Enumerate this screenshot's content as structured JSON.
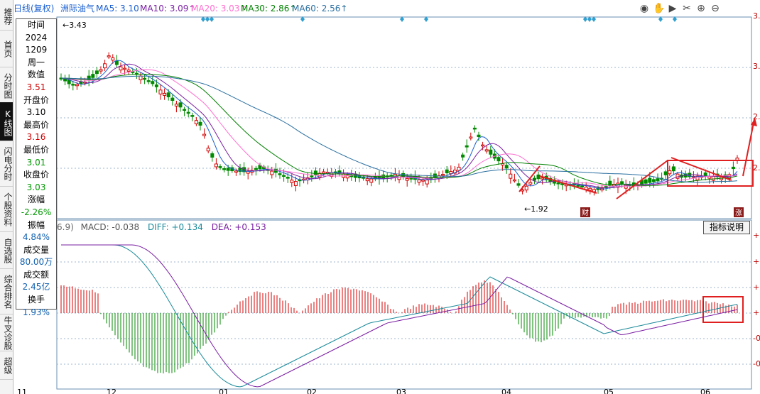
{
  "sidebar": {
    "tabs": [
      {
        "label": "推荐",
        "active": false
      },
      {
        "label": "首页",
        "active": false
      },
      {
        "label": "分时图",
        "active": false
      },
      {
        "label": "K线图",
        "active": true
      },
      {
        "label": "闪电分时",
        "active": false
      },
      {
        "label": "个股资料",
        "active": false
      },
      {
        "label": "自选股",
        "active": false
      },
      {
        "label": "综合排名",
        "active": false
      },
      {
        "label": "牛叉诊股",
        "active": false
      },
      {
        "label": "超级",
        "active": false
      }
    ]
  },
  "header": {
    "period": "日线(复权)",
    "stock_name": "洲际油气",
    "ma": [
      {
        "label": "MA5: 3.10",
        "color": "#1a5fd0"
      },
      {
        "label": "MA10: 3.09↑",
        "color": "#7a1fa2"
      },
      {
        "label": "MA20: 3.03↑",
        "color": "#ff6fd0"
      },
      {
        "label": "MA30: 2.86↑",
        "color": "#008000"
      },
      {
        "label": "MA60: 2.56↑",
        "color": "#2a6fa0"
      }
    ],
    "icons": [
      "eye-icon",
      "hand-icon",
      "play-icon",
      "scissors-icon",
      "zoom-in-icon",
      "zoom-out-icon"
    ]
  },
  "infopanel": {
    "rows": [
      {
        "text": "时间",
        "cls": "v"
      },
      {
        "text": "2024",
        "cls": "v"
      },
      {
        "text": "1209",
        "cls": "v"
      },
      {
        "text": "周一",
        "cls": "v"
      },
      {
        "text": "数值",
        "cls": "v"
      },
      {
        "text": "3.51",
        "cls": "red"
      },
      {
        "text": "开盘价",
        "cls": "v"
      },
      {
        "text": "3.10",
        "cls": "v"
      },
      {
        "text": "最高价",
        "cls": "v"
      },
      {
        "text": "3.16",
        "cls": "red"
      },
      {
        "text": "最低价",
        "cls": "v"
      },
      {
        "text": "3.01",
        "cls": "green"
      },
      {
        "text": "收盘价",
        "cls": "v"
      },
      {
        "text": "3.03",
        "cls": "green"
      },
      {
        "text": "涨幅",
        "cls": "v"
      },
      {
        "text": "-2.26%",
        "cls": "green"
      },
      {
        "text": "振幅",
        "cls": "v"
      },
      {
        "text": "4.84%",
        "cls": "blue"
      },
      {
        "text": "成交量",
        "cls": "v"
      },
      {
        "text": "80.00万",
        "cls": "blue"
      },
      {
        "text": "成交额",
        "cls": "v"
      },
      {
        "text": "2.45亿",
        "cls": "blue"
      },
      {
        "text": "换手",
        "cls": "v"
      },
      {
        "text": "1.93%",
        "cls": "blue"
      }
    ]
  },
  "price_labels": {
    "high": "3.43",
    "low": "1.92",
    "badge_cai": "财",
    "badge_zhang": "涨"
  },
  "macd": {
    "params": "6.9)",
    "macd_label": "MACD: -0.038",
    "diff_label": "DIFF: +0.134",
    "dea_label": "DEA: +0.153",
    "explain_button": "指标说明"
  },
  "axis": {
    "price_ticks": [
      "3.",
      "3.",
      "2.",
      "2."
    ],
    "macd_ticks": [
      "+0",
      "+0",
      "+0",
      "+0",
      "-0",
      "-0"
    ],
    "months": [
      "11",
      "12",
      "01",
      "02",
      "03",
      "04",
      "05",
      "06"
    ]
  },
  "colors": {
    "up": "#d40000",
    "down": "#008a00",
    "grid": "#9fb6cf",
    "annotation": "#e02020",
    "marker": "#30a0d0"
  }
}
